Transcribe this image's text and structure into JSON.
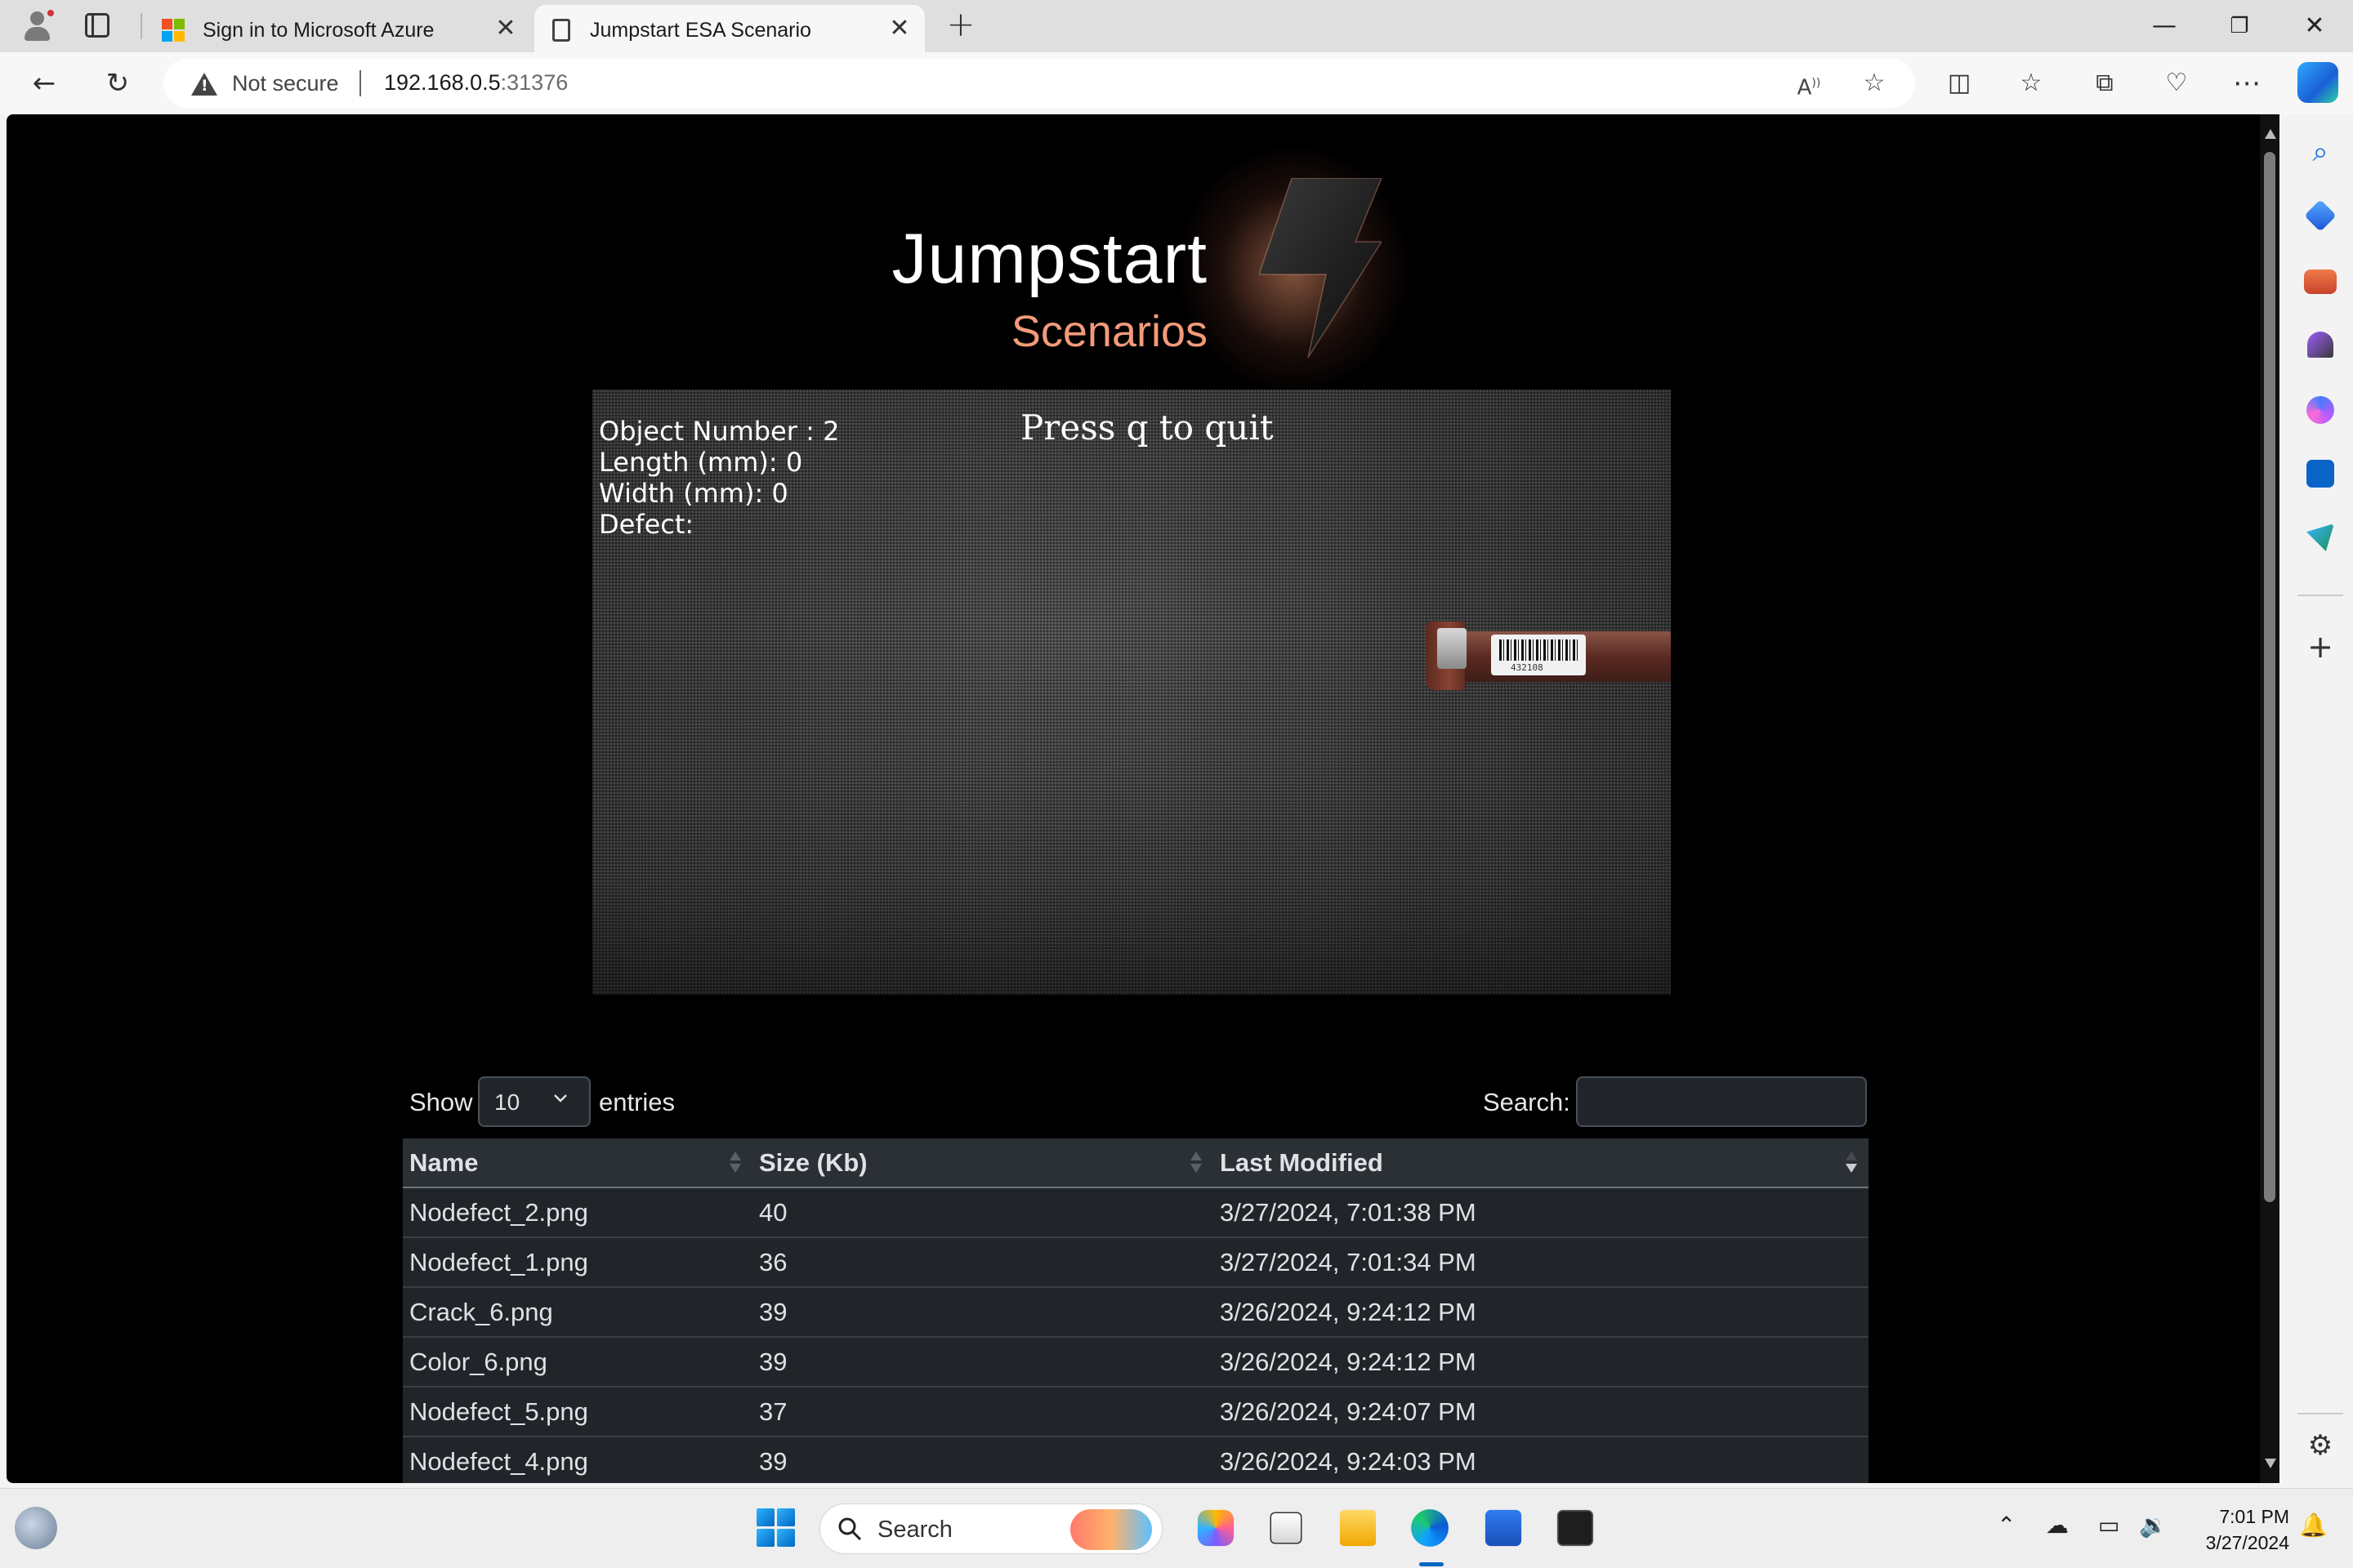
{
  "browser": {
    "tabs": [
      {
        "title": "Sign in to Microsoft Azure",
        "favicon": "microsoft-logo-icon",
        "active": false
      },
      {
        "title": "Jumpstart ESA Scenario",
        "favicon": "page-icon",
        "active": true
      }
    ],
    "address": {
      "security_label": "Not secure",
      "host": "192.168.0.5",
      "port": ":31376"
    },
    "window_controls": {
      "minimize": "—",
      "restore": "❐",
      "close": "✕"
    }
  },
  "page": {
    "logo": {
      "title": "Jumpstart",
      "subtitle": "Scenarios",
      "accent_color": "#f29a7a"
    },
    "video": {
      "object_number_line": "Object Number : 2",
      "length_line": "Length (mm): 0",
      "width_line": "Width (mm): 0",
      "defect_line": "Defect:",
      "quit_hint": "Press q to quit",
      "tube_label_text": "432108"
    },
    "table_controls": {
      "show_label": "Show",
      "entries_value": "10",
      "entries_label": "entries",
      "search_label": "Search:",
      "search_value": ""
    },
    "table": {
      "headers": {
        "name": "Name",
        "size": "Size (Kb)",
        "modified": "Last Modified"
      },
      "rows": [
        {
          "name": "Nodefect_2.png",
          "size": "40",
          "modified": "3/27/2024, 7:01:38 PM"
        },
        {
          "name": "Nodefect_1.png",
          "size": "36",
          "modified": "3/27/2024, 7:01:34 PM"
        },
        {
          "name": "Crack_6.png",
          "size": "39",
          "modified": "3/26/2024, 9:24:12 PM"
        },
        {
          "name": "Color_6.png",
          "size": "39",
          "modified": "3/26/2024, 9:24:12 PM"
        },
        {
          "name": "Nodefect_5.png",
          "size": "37",
          "modified": "3/26/2024, 9:24:07 PM"
        },
        {
          "name": "Nodefect_4.png",
          "size": "39",
          "modified": "3/26/2024, 9:24:03 PM"
        }
      ]
    }
  },
  "taskbar": {
    "search_label": "Search",
    "time": "7:01 PM",
    "date": "3/27/2024"
  }
}
